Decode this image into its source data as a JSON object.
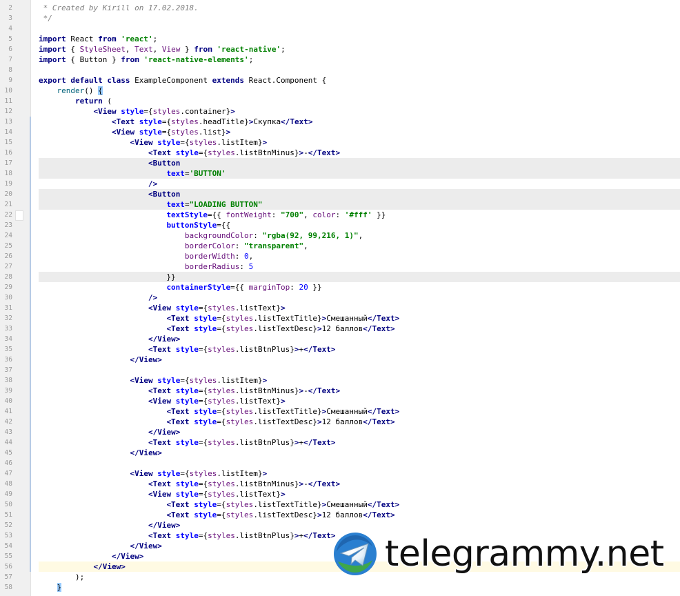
{
  "editor": {
    "first_line_number": 2,
    "lines": [
      [
        {
          "t": " * Created by ",
          "c": "cm"
        },
        {
          "t": "Kirill",
          "c": "cm"
        },
        {
          "t": " on 17.02.2018.",
          "c": "cm"
        }
      ],
      [
        {
          "t": " */",
          "c": "cm"
        }
      ],
      [],
      [
        {
          "t": "import",
          "c": "k"
        },
        {
          "t": " React "
        },
        {
          "t": "from",
          "c": "k"
        },
        {
          "t": " "
        },
        {
          "t": "'react'",
          "c": "s"
        },
        {
          "t": ";"
        }
      ],
      [
        {
          "t": "import",
          "c": "k"
        },
        {
          "t": " { "
        },
        {
          "t": "StyleSheet",
          "c": "v"
        },
        {
          "t": ", "
        },
        {
          "t": "Text",
          "c": "v"
        },
        {
          "t": ", "
        },
        {
          "t": "View",
          "c": "v"
        },
        {
          "t": " } "
        },
        {
          "t": "from",
          "c": "k"
        },
        {
          "t": " "
        },
        {
          "t": "'react-native'",
          "c": "s"
        },
        {
          "t": ";"
        }
      ],
      [
        {
          "t": "import",
          "c": "k"
        },
        {
          "t": " { Button } "
        },
        {
          "t": "from",
          "c": "k"
        },
        {
          "t": " "
        },
        {
          "t": "'react-native-elements'",
          "c": "s"
        },
        {
          "t": ";"
        }
      ],
      [],
      [
        {
          "t": "export default class",
          "c": "k"
        },
        {
          "t": " ExampleComponent "
        },
        {
          "t": "extends",
          "c": "k"
        },
        {
          "t": " React.Component {"
        }
      ],
      [
        {
          "t": "    "
        },
        {
          "t": "render",
          "c": "fn"
        },
        {
          "t": "() "
        },
        {
          "t": "{",
          "c": "br"
        }
      ],
      [
        {
          "t": "        "
        },
        {
          "t": "return",
          "c": "k"
        },
        {
          "t": " ("
        }
      ],
      [
        {
          "t": "            "
        },
        {
          "t": "<View ",
          "c": "t"
        },
        {
          "t": "style",
          "c": "at"
        },
        {
          "t": "={"
        },
        {
          "t": "styles",
          "c": "v"
        },
        {
          "t": ".container}"
        },
        {
          "t": ">",
          "c": "t"
        }
      ],
      [
        {
          "t": "                "
        },
        {
          "t": "<Text ",
          "c": "t"
        },
        {
          "t": "style",
          "c": "at"
        },
        {
          "t": "={"
        },
        {
          "t": "styles",
          "c": "v"
        },
        {
          "t": ".headTitle}"
        },
        {
          "t": ">",
          "c": "t"
        },
        {
          "t": "Скупка"
        },
        {
          "t": "</Text>",
          "c": "t"
        }
      ],
      [
        {
          "t": "                "
        },
        {
          "t": "<View ",
          "c": "t"
        },
        {
          "t": "style",
          "c": "at"
        },
        {
          "t": "={"
        },
        {
          "t": "styles",
          "c": "v"
        },
        {
          "t": ".list}"
        },
        {
          "t": ">",
          "c": "t"
        }
      ],
      [
        {
          "t": "                    "
        },
        {
          "t": "<View ",
          "c": "t"
        },
        {
          "t": "style",
          "c": "at"
        },
        {
          "t": "={"
        },
        {
          "t": "styles",
          "c": "v"
        },
        {
          "t": ".listItem}"
        },
        {
          "t": ">",
          "c": "t"
        }
      ],
      [
        {
          "t": "                        "
        },
        {
          "t": "<Text ",
          "c": "t"
        },
        {
          "t": "style",
          "c": "at"
        },
        {
          "t": "={"
        },
        {
          "t": "styles",
          "c": "v"
        },
        {
          "t": ".listBtnMinus}"
        },
        {
          "t": ">",
          "c": "t"
        },
        {
          "t": "-"
        },
        {
          "t": "</Text>",
          "c": "t"
        }
      ],
      [
        {
          "t": "                        "
        },
        {
          "t": "<Button",
          "c": "t"
        }
      ],
      [
        {
          "t": "                            "
        },
        {
          "t": "text",
          "c": "at"
        },
        {
          "t": "="
        },
        {
          "t": "'BUTTON'",
          "c": "s"
        }
      ],
      [
        {
          "t": "                        "
        },
        {
          "t": "/>",
          "c": "t"
        }
      ],
      [
        {
          "t": "                        "
        },
        {
          "t": "<Button",
          "c": "t"
        }
      ],
      [
        {
          "t": "                            "
        },
        {
          "t": "text",
          "c": "at"
        },
        {
          "t": "="
        },
        {
          "t": "\"LOADING BUTTON\"",
          "c": "s"
        }
      ],
      [
        {
          "t": "                            "
        },
        {
          "t": "textStyle",
          "c": "at"
        },
        {
          "t": "={{ "
        },
        {
          "t": "fontWeight",
          "c": "v"
        },
        {
          "t": ": "
        },
        {
          "t": "\"700\"",
          "c": "s"
        },
        {
          "t": ", "
        },
        {
          "t": "color",
          "c": "v"
        },
        {
          "t": ": "
        },
        {
          "t": "'#fff'",
          "c": "s"
        },
        {
          "t": " }}"
        }
      ],
      [
        {
          "t": "                            "
        },
        {
          "t": "buttonStyle",
          "c": "at"
        },
        {
          "t": "={{"
        }
      ],
      [
        {
          "t": "                                "
        },
        {
          "t": "backgroundColor",
          "c": "v"
        },
        {
          "t": ": "
        },
        {
          "t": "\"rgba(92, 99,216, 1)\"",
          "c": "s"
        },
        {
          "t": ","
        }
      ],
      [
        {
          "t": "                                "
        },
        {
          "t": "borderColor",
          "c": "v"
        },
        {
          "t": ": "
        },
        {
          "t": "\"transparent\"",
          "c": "s"
        },
        {
          "t": ","
        }
      ],
      [
        {
          "t": "                                "
        },
        {
          "t": "borderWidth",
          "c": "v"
        },
        {
          "t": ": "
        },
        {
          "t": "0",
          "c": "n"
        },
        {
          "t": ","
        }
      ],
      [
        {
          "t": "                                "
        },
        {
          "t": "borderRadius",
          "c": "v"
        },
        {
          "t": ": "
        },
        {
          "t": "5",
          "c": "n"
        }
      ],
      [
        {
          "t": "                            }}"
        }
      ],
      [
        {
          "t": "                            "
        },
        {
          "t": "containerStyle",
          "c": "at"
        },
        {
          "t": "={{ "
        },
        {
          "t": "marginTop",
          "c": "v"
        },
        {
          "t": ": "
        },
        {
          "t": "20",
          "c": "n"
        },
        {
          "t": " }}"
        }
      ],
      [
        {
          "t": "                        "
        },
        {
          "t": "/>",
          "c": "t"
        }
      ],
      [
        {
          "t": "                        "
        },
        {
          "t": "<View ",
          "c": "t"
        },
        {
          "t": "style",
          "c": "at"
        },
        {
          "t": "={"
        },
        {
          "t": "styles",
          "c": "v"
        },
        {
          "t": ".listText}"
        },
        {
          "t": ">",
          "c": "t"
        }
      ],
      [
        {
          "t": "                            "
        },
        {
          "t": "<Text ",
          "c": "t"
        },
        {
          "t": "style",
          "c": "at"
        },
        {
          "t": "={"
        },
        {
          "t": "styles",
          "c": "v"
        },
        {
          "t": ".listTextTitle}"
        },
        {
          "t": ">",
          "c": "t"
        },
        {
          "t": "Смешанный"
        },
        {
          "t": "</Text>",
          "c": "t"
        }
      ],
      [
        {
          "t": "                            "
        },
        {
          "t": "<Text ",
          "c": "t"
        },
        {
          "t": "style",
          "c": "at"
        },
        {
          "t": "={"
        },
        {
          "t": "styles",
          "c": "v"
        },
        {
          "t": ".listTextDesc}"
        },
        {
          "t": ">",
          "c": "t"
        },
        {
          "t": "12 баллов"
        },
        {
          "t": "</Text>",
          "c": "t"
        }
      ],
      [
        {
          "t": "                        "
        },
        {
          "t": "</View>",
          "c": "t"
        }
      ],
      [
        {
          "t": "                        "
        },
        {
          "t": "<Text ",
          "c": "t"
        },
        {
          "t": "style",
          "c": "at"
        },
        {
          "t": "={"
        },
        {
          "t": "styles",
          "c": "v"
        },
        {
          "t": ".listBtnPlus}"
        },
        {
          "t": ">",
          "c": "t"
        },
        {
          "t": "+"
        },
        {
          "t": "</Text>",
          "c": "t"
        }
      ],
      [
        {
          "t": "                    "
        },
        {
          "t": "</View>",
          "c": "t"
        }
      ],
      [],
      [
        {
          "t": "                    "
        },
        {
          "t": "<View ",
          "c": "t"
        },
        {
          "t": "style",
          "c": "at"
        },
        {
          "t": "={"
        },
        {
          "t": "styles",
          "c": "v"
        },
        {
          "t": ".listItem}"
        },
        {
          "t": ">",
          "c": "t"
        }
      ],
      [
        {
          "t": "                        "
        },
        {
          "t": "<Text ",
          "c": "t"
        },
        {
          "t": "style",
          "c": "at"
        },
        {
          "t": "={"
        },
        {
          "t": "styles",
          "c": "v"
        },
        {
          "t": ".listBtnMinus}"
        },
        {
          "t": ">",
          "c": "t"
        },
        {
          "t": "-"
        },
        {
          "t": "</Text>",
          "c": "t"
        }
      ],
      [
        {
          "t": "                        "
        },
        {
          "t": "<View ",
          "c": "t"
        },
        {
          "t": "style",
          "c": "at"
        },
        {
          "t": "={"
        },
        {
          "t": "styles",
          "c": "v"
        },
        {
          "t": ".listText}"
        },
        {
          "t": ">",
          "c": "t"
        }
      ],
      [
        {
          "t": "                            "
        },
        {
          "t": "<Text ",
          "c": "t"
        },
        {
          "t": "style",
          "c": "at"
        },
        {
          "t": "={"
        },
        {
          "t": "styles",
          "c": "v"
        },
        {
          "t": ".listTextTitle}"
        },
        {
          "t": ">",
          "c": "t"
        },
        {
          "t": "Смешанный"
        },
        {
          "t": "</Text>",
          "c": "t"
        }
      ],
      [
        {
          "t": "                            "
        },
        {
          "t": "<Text ",
          "c": "t"
        },
        {
          "t": "style",
          "c": "at"
        },
        {
          "t": "={"
        },
        {
          "t": "styles",
          "c": "v"
        },
        {
          "t": ".listTextDesc}"
        },
        {
          "t": ">",
          "c": "t"
        },
        {
          "t": "12 баллов"
        },
        {
          "t": "</Text>",
          "c": "t"
        }
      ],
      [
        {
          "t": "                        "
        },
        {
          "t": "</View>",
          "c": "t"
        }
      ],
      [
        {
          "t": "                        "
        },
        {
          "t": "<Text ",
          "c": "t"
        },
        {
          "t": "style",
          "c": "at"
        },
        {
          "t": "={"
        },
        {
          "t": "styles",
          "c": "v"
        },
        {
          "t": ".listBtnPlus}"
        },
        {
          "t": ">",
          "c": "t"
        },
        {
          "t": "+"
        },
        {
          "t": "</Text>",
          "c": "t"
        }
      ],
      [
        {
          "t": "                    "
        },
        {
          "t": "</View>",
          "c": "t"
        }
      ],
      [],
      [
        {
          "t": "                    "
        },
        {
          "t": "<View ",
          "c": "t"
        },
        {
          "t": "style",
          "c": "at"
        },
        {
          "t": "={"
        },
        {
          "t": "styles",
          "c": "v"
        },
        {
          "t": ".listItem}"
        },
        {
          "t": ">",
          "c": "t"
        }
      ],
      [
        {
          "t": "                        "
        },
        {
          "t": "<Text ",
          "c": "t"
        },
        {
          "t": "style",
          "c": "at"
        },
        {
          "t": "={"
        },
        {
          "t": "styles",
          "c": "v"
        },
        {
          "t": ".listBtnMinus}"
        },
        {
          "t": ">",
          "c": "t"
        },
        {
          "t": "-"
        },
        {
          "t": "</Text>",
          "c": "t"
        }
      ],
      [
        {
          "t": "                        "
        },
        {
          "t": "<View ",
          "c": "t"
        },
        {
          "t": "style",
          "c": "at"
        },
        {
          "t": "={"
        },
        {
          "t": "styles",
          "c": "v"
        },
        {
          "t": ".listText}"
        },
        {
          "t": ">",
          "c": "t"
        }
      ],
      [
        {
          "t": "                            "
        },
        {
          "t": "<Text ",
          "c": "t"
        },
        {
          "t": "style",
          "c": "at"
        },
        {
          "t": "={"
        },
        {
          "t": "styles",
          "c": "v"
        },
        {
          "t": ".listTextTitle}"
        },
        {
          "t": ">",
          "c": "t"
        },
        {
          "t": "Смешанный"
        },
        {
          "t": "</Text>",
          "c": "t"
        }
      ],
      [
        {
          "t": "                            "
        },
        {
          "t": "<Text ",
          "c": "t"
        },
        {
          "t": "style",
          "c": "at"
        },
        {
          "t": "={"
        },
        {
          "t": "styles",
          "c": "v"
        },
        {
          "t": ".listTextDesc}"
        },
        {
          "t": ">",
          "c": "t"
        },
        {
          "t": "12 баллов"
        },
        {
          "t": "</Text>",
          "c": "t"
        }
      ],
      [
        {
          "t": "                        "
        },
        {
          "t": "</View>",
          "c": "t"
        }
      ],
      [
        {
          "t": "                        "
        },
        {
          "t": "<Text ",
          "c": "t"
        },
        {
          "t": "style",
          "c": "at"
        },
        {
          "t": "={"
        },
        {
          "t": "styles",
          "c": "v"
        },
        {
          "t": ".listBtnPlus}"
        },
        {
          "t": ">",
          "c": "t"
        },
        {
          "t": "+"
        },
        {
          "t": "</Text>",
          "c": "t"
        }
      ],
      [
        {
          "t": "                    "
        },
        {
          "t": "</View>",
          "c": "t"
        }
      ],
      [
        {
          "t": "                "
        },
        {
          "t": "</View>",
          "c": "t"
        }
      ],
      [
        {
          "t": "            "
        },
        {
          "t": "</View>",
          "c": "t"
        }
      ],
      [
        {
          "t": "        );"
        }
      ],
      [
        {
          "t": "    "
        },
        {
          "t": "}",
          "c": "br"
        }
      ]
    ],
    "highlighted_lines": [
      17,
      18,
      20,
      21,
      28
    ],
    "caret_line": 56
  },
  "watermark": {
    "text": "telegrammy.net",
    "icon": "telegram-paper-plane-icon"
  },
  "colors": {
    "keyword": "#000080",
    "string": "#008000",
    "attribute": "#0000ff",
    "comment": "#808080",
    "gutter": "#f0f0f0",
    "telegram_blue": "#2ca5e0"
  }
}
